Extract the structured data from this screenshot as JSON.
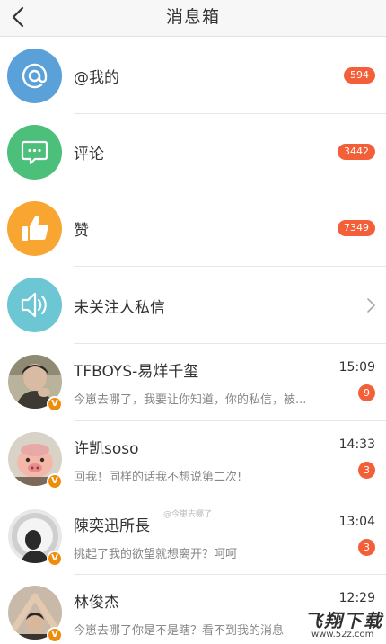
{
  "header": {
    "title": "消息箱"
  },
  "categories": [
    {
      "label": "@我的",
      "count": "594",
      "icon": "at-icon",
      "color": "#5aa0d9"
    },
    {
      "label": "评论",
      "count": "3442",
      "icon": "comment-icon",
      "color": "#4cbf7a"
    },
    {
      "label": "赞",
      "count": "7349",
      "icon": "thumbs-up-icon",
      "color": "#f8a532"
    },
    {
      "label": "未关注人私信",
      "icon": "speaker-icon",
      "color": "#6dc6d4"
    }
  ],
  "messages": [
    {
      "name": "TFBOYS-易烊千玺",
      "time": "15:09",
      "preview": "今崽去哪了，我要让你知道，你的私信，被...",
      "count": "9",
      "verified": "V"
    },
    {
      "name": "许凯soso",
      "time": "14:33",
      "preview": "回我！同样的话我不想说第二次!",
      "count": "3",
      "verified": "V"
    },
    {
      "name": "陳奕迅所長",
      "time": "13:04",
      "preview": "挑起了我的欲望就想离开？呵呵",
      "count": "3",
      "verified": "V"
    },
    {
      "name": "林俊杰",
      "time": "12:29",
      "preview": "今崽去哪了你是不是瞎？看不到我的消息",
      "verified": "V"
    }
  ],
  "watermark": "@今崽去哪了",
  "brand": {
    "title": "飞翔下载",
    "url": "www.52z.com"
  }
}
